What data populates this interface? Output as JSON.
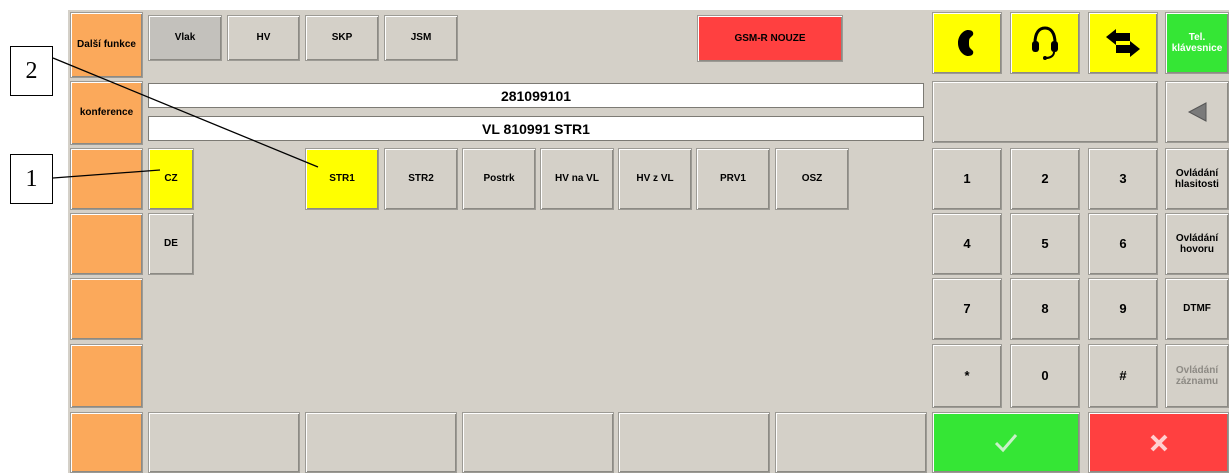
{
  "callouts": [
    "2",
    "1"
  ],
  "left_column": {
    "more_functions": "Další funkce",
    "conference": "konference"
  },
  "top_tabs": [
    "Vlak",
    "HV",
    "SKP",
    "JSM"
  ],
  "emergency_button": "GSM-R NOUZE",
  "top_right": {
    "keypad_toggle": "Tel. klávesnice"
  },
  "display": {
    "number": "281099101",
    "name": "VL 810991 STR1"
  },
  "contacts_row1": [
    "CZ",
    "STR1",
    "STR2",
    "Postrk",
    "HV na VL",
    "HV z VL",
    "PRV1",
    "OSZ"
  ],
  "contacts_row2": [
    "DE"
  ],
  "keypad": [
    "1",
    "2",
    "3",
    "4",
    "5",
    "6",
    "7",
    "8",
    "9",
    "*",
    "0",
    "#"
  ],
  "side_controls": {
    "volume": "Ovládání hlasitosti",
    "call": "Ovládání hovoru",
    "dtmf": "DTMF",
    "recording": "Ovládání záznamu"
  },
  "colors": {
    "orange": "#fba95b",
    "yellow": "#ffff00",
    "red": "#ff4040",
    "green": "#35e635",
    "panel": "#d4d0c8"
  }
}
